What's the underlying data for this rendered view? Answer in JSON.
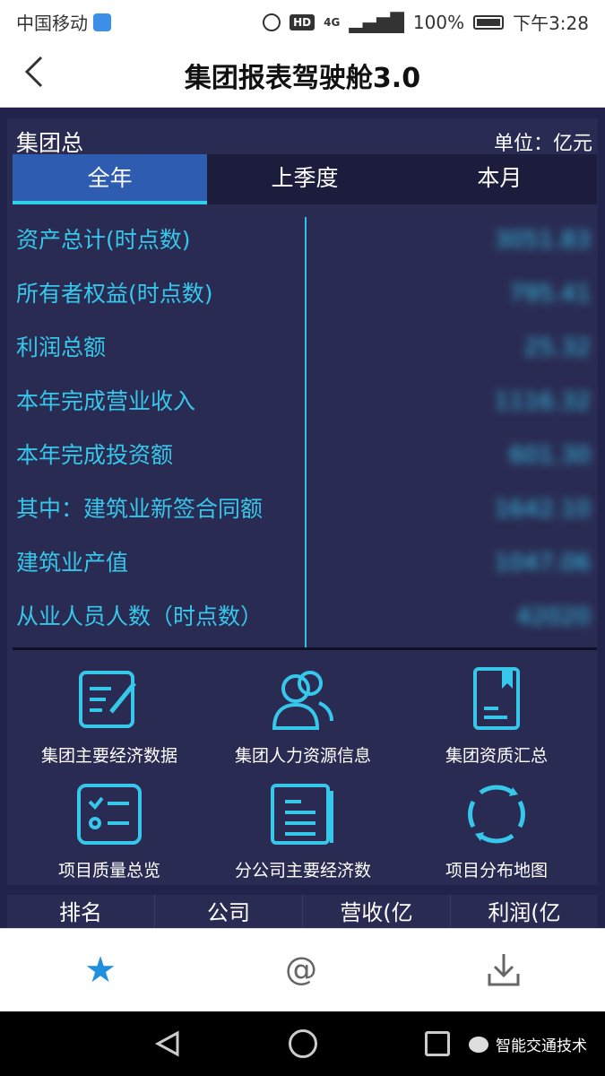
{
  "status_bar": {
    "carrier": "中国移动",
    "network": "4G",
    "battery": "100%",
    "time": "下午3:28",
    "hd": "HD"
  },
  "nav": {
    "title": "集团报表驾驶舱3.0"
  },
  "dashboard": {
    "group_label": "集团总",
    "unit_label": "单位：亿元",
    "tabs": [
      {
        "label": "全年",
        "active": true
      },
      {
        "label": "上季度",
        "active": false
      },
      {
        "label": "本月",
        "active": false
      }
    ],
    "metrics": [
      {
        "label": "资产总计(时点数)",
        "value": "3051.83"
      },
      {
        "label": "所有者权益(时点数)",
        "value": "795.41"
      },
      {
        "label": "利润总额",
        "value": "25.32"
      },
      {
        "label": "本年完成营业收入",
        "value": "1116.32"
      },
      {
        "label": "本年完成投资额",
        "value": "601.30"
      },
      {
        "label": "其中：建筑业新签合同额",
        "value": "1642.10"
      },
      {
        "label": "建筑业产值",
        "value": "1047.06"
      },
      {
        "label": "从业人员人数（时点数）",
        "value": "42020"
      }
    ],
    "tiles": [
      {
        "label": "集团主要经济数据",
        "icon": "edit-document-icon"
      },
      {
        "label": "集团人力资源信息",
        "icon": "users-icon"
      },
      {
        "label": "集团资质汇总",
        "icon": "certificate-icon"
      },
      {
        "label": "项目质量总览",
        "icon": "checklist-icon"
      },
      {
        "label": "分公司主要经济数",
        "icon": "report-icon"
      },
      {
        "label": "项目分布地图",
        "icon": "refresh-circle-icon"
      }
    ],
    "table_headers": [
      "排名",
      "公司",
      "营收(亿",
      "利润(亿"
    ]
  },
  "toolbar": {
    "items": [
      "star-icon",
      "at-icon",
      "download-icon"
    ]
  },
  "watermark": {
    "text": "智能交通技术"
  },
  "colors": {
    "accent": "#36c7ea",
    "tab_active": "#2e5cb0",
    "panel_bg": "#2a2b52",
    "star": "#1f8fe0"
  }
}
